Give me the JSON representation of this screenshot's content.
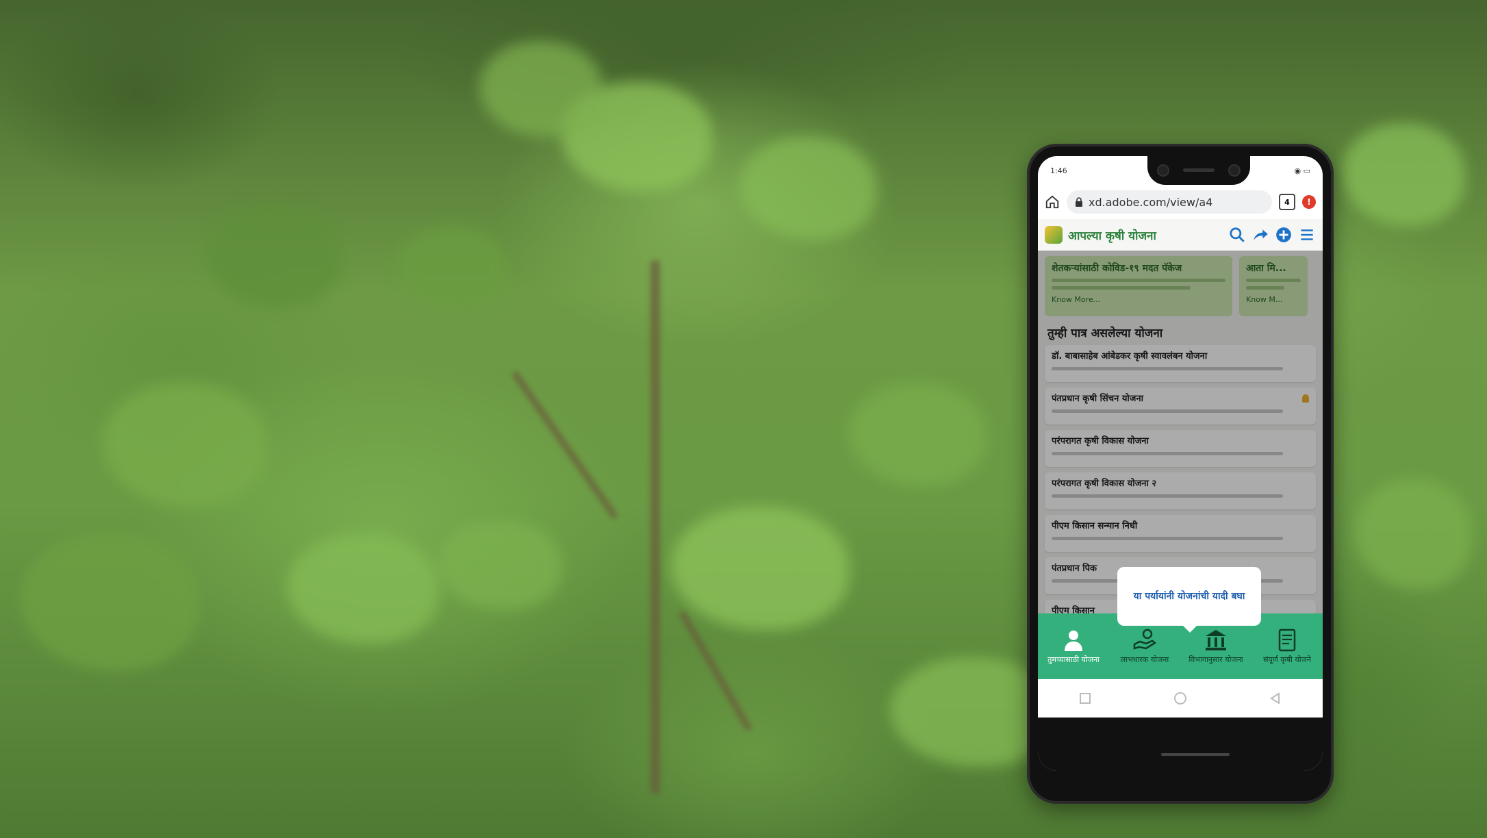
{
  "status": {
    "time": "1:46",
    "right": "◉ ▭"
  },
  "browser": {
    "url": "xd.adobe.com/view/a4",
    "tab_count": "4"
  },
  "app": {
    "title": "आपल्या कृषी योजना"
  },
  "banners": [
    {
      "title": "शेतकऱ्यांसाठी कोविड-१९ मदत पॅकेज",
      "more": "Know More..."
    },
    {
      "title": "आता मि...",
      "more": "Know M..."
    }
  ],
  "section_title": "तुम्ही पात्र असलेल्या योजना",
  "schemes": [
    {
      "title": "डॉ. बाबासाहेब आंबेडकर कृषी स्वावलंबन योजना"
    },
    {
      "title": "पंतप्रधान कृषी सिंचन योजना"
    },
    {
      "title": "परंपरागत कृषी विकास योजना"
    },
    {
      "title": "परंपरागत कृषी विकास योजना २"
    },
    {
      "title": "पीएम किसान सन्मान निधी"
    },
    {
      "title": "पंतप्रधान पिक"
    },
    {
      "title": "पीएम किसान"
    }
  ],
  "tooltip": "या पर्यायांनी योजनांची यादी बघा",
  "bottom_nav": [
    {
      "label": "तुमच्यासाठी योजना",
      "icon": "person-icon"
    },
    {
      "label": "लाभधारक योजना",
      "icon": "hand-coins-icon"
    },
    {
      "label": "विभागानुसार योजना",
      "icon": "bank-icon"
    },
    {
      "label": "संपूर्ण कृषी योजने",
      "icon": "document-icon"
    }
  ],
  "colors": {
    "accent": "#34b07c",
    "title_green": "#2a7f3a",
    "link_blue": "#1e73c8"
  }
}
